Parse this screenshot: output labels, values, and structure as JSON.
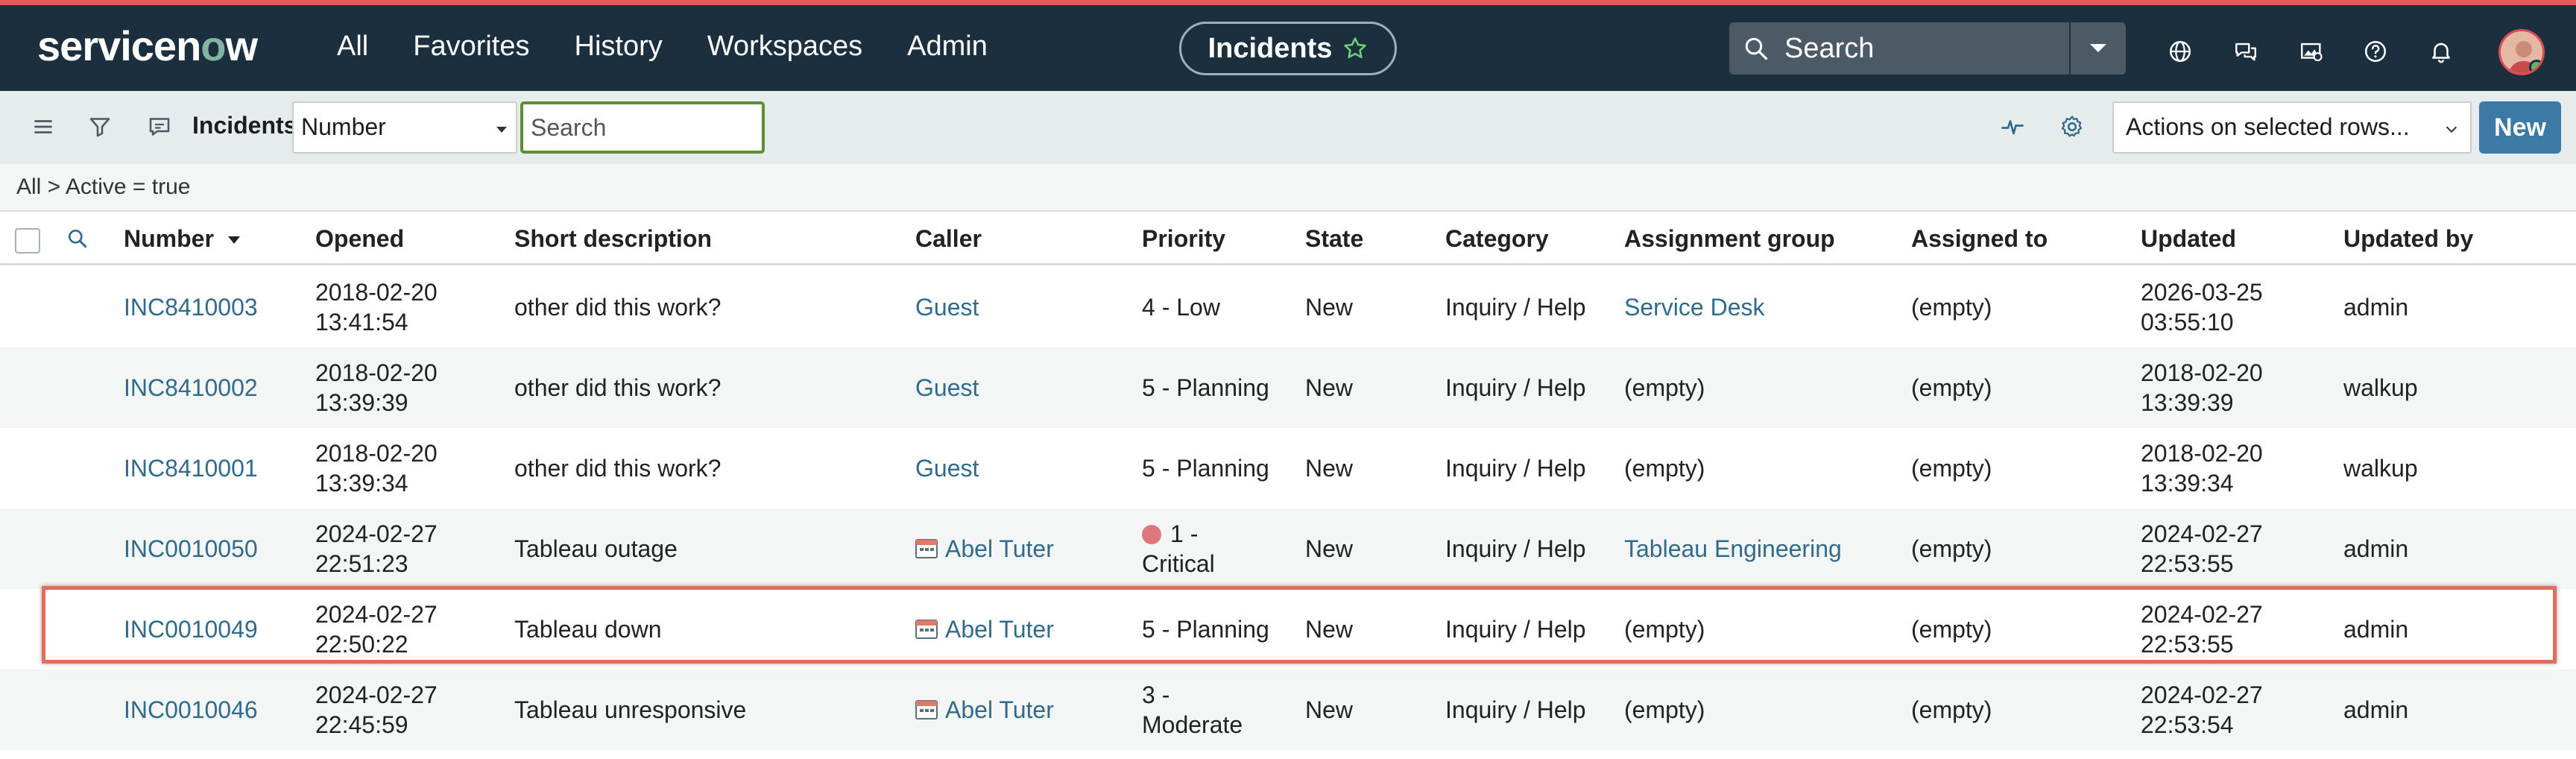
{
  "brand": {
    "logo_text_a": "servicen",
    "logo_o": "o",
    "logo_text_b": "w",
    "red_bar_color": "#e15c5c"
  },
  "nav": {
    "links": [
      "All",
      "Favorites",
      "History",
      "Workspaces",
      "Admin"
    ],
    "context_pill": "Incidents",
    "search_placeholder": "Search",
    "icons": [
      "globe-icon",
      "chat-icon",
      "image-icon",
      "help-icon",
      "bell-icon",
      "avatar"
    ]
  },
  "toolbar": {
    "title": "Incidents",
    "field_select": "Number",
    "search_placeholder": "Search",
    "actions_select": "Actions on selected rows...",
    "new_label": "New"
  },
  "breadcrumb": "All > Active = true",
  "table": {
    "headers": {
      "number": "Number",
      "opened": "Opened",
      "short_description": "Short description",
      "caller": "Caller",
      "priority": "Priority",
      "state": "State",
      "category": "Category",
      "assignment_group": "Assignment group",
      "assigned_to": "Assigned to",
      "updated": "Updated",
      "updated_by": "Updated by"
    },
    "rows": [
      {
        "number": "INC8410003",
        "opened_date": "2018-02-20",
        "opened_time": "13:41:54",
        "short_description": "other did this work?",
        "caller": "Guest",
        "priority_a": "4 - Low",
        "priority_b": "",
        "state": "New",
        "category": "Inquiry / Help",
        "assignment_group": "Service Desk",
        "assigned_to": "(empty)",
        "updated_date": "2026-03-25",
        "updated_time": "03:55:10",
        "updated_by": "admin"
      },
      {
        "number": "INC8410002",
        "opened_date": "2018-02-20",
        "opened_time": "13:39:39",
        "short_description": "other did this work?",
        "caller": "Guest",
        "priority_a": "5 - Planning",
        "priority_b": "",
        "state": "New",
        "category": "Inquiry / Help",
        "assignment_group": "(empty)",
        "assigned_to": "(empty)",
        "updated_date": "2018-02-20",
        "updated_time": "13:39:39",
        "updated_by": "walkup"
      },
      {
        "number": "INC8410001",
        "opened_date": "2018-02-20",
        "opened_time": "13:39:34",
        "short_description": "other did this work?",
        "caller": "Guest",
        "priority_a": "5 - Planning",
        "priority_b": "",
        "state": "New",
        "category": "Inquiry / Help",
        "assignment_group": "(empty)",
        "assigned_to": "(empty)",
        "updated_date": "2018-02-20",
        "updated_time": "13:39:34",
        "updated_by": "walkup"
      },
      {
        "number": "INC0010050",
        "opened_date": "2024-02-27",
        "opened_time": "22:51:23",
        "short_description": "Tableau outage",
        "caller": "Abel Tuter",
        "priority_a": "1 -",
        "priority_b": "Critical",
        "state": "New",
        "category": "Inquiry / Help",
        "assignment_group": "Tableau Engineering",
        "assigned_to": "(empty)",
        "updated_date": "2024-02-27",
        "updated_time": "22:53:55",
        "updated_by": "admin"
      },
      {
        "number": "INC0010049",
        "opened_date": "2024-02-27",
        "opened_time": "22:50:22",
        "short_description": "Tableau down",
        "caller": "Abel Tuter",
        "priority_a": "5 - Planning",
        "priority_b": "",
        "state": "New",
        "category": "Inquiry / Help",
        "assignment_group": "(empty)",
        "assigned_to": "(empty)",
        "updated_date": "2024-02-27",
        "updated_time": "22:53:55",
        "updated_by": "admin"
      },
      {
        "number": "INC0010046",
        "opened_date": "2024-02-27",
        "opened_time": "22:45:59",
        "short_description": "Tableau unresponsive",
        "caller": "Abel Tuter",
        "priority_a": "3 -",
        "priority_b": "Moderate",
        "state": "New",
        "category": "Inquiry / Help",
        "assignment_group": "(empty)",
        "assigned_to": "(empty)",
        "updated_date": "2024-02-27",
        "updated_time": "22:53:54",
        "updated_by": "admin"
      }
    ]
  }
}
